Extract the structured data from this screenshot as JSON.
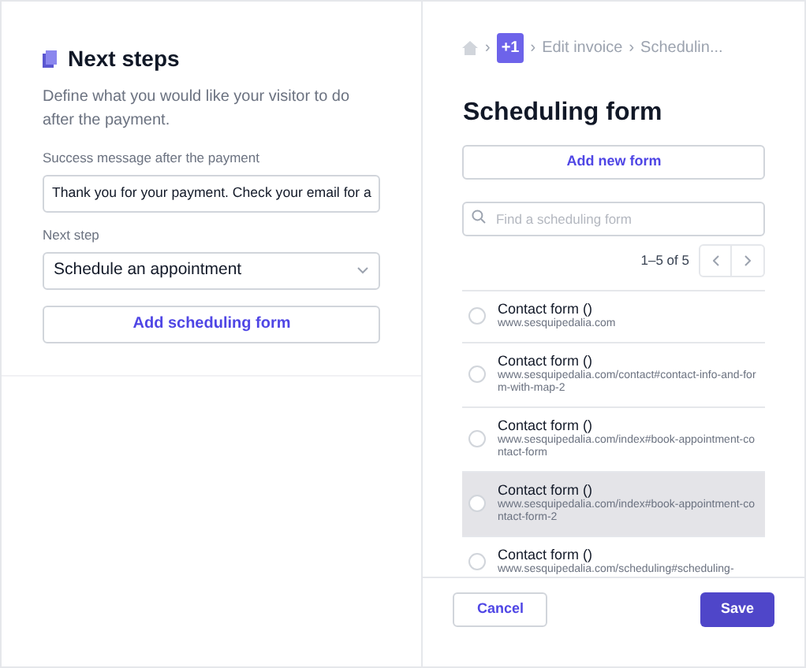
{
  "next_steps": {
    "title": "Next steps",
    "description": "Define what you would like your visitor to do after the payment.",
    "success_message": {
      "label": "Success message after the payment",
      "value": "Thank you for your payment. Check your email for a"
    },
    "next_step": {
      "label": "Next step",
      "value": "Schedule an appointment"
    },
    "add_button": "Add scheduling form"
  },
  "breadcrumb": {
    "separator": "›",
    "badge": "+1",
    "items": [
      "Edit invoice",
      "Schedulin..."
    ]
  },
  "scheduling": {
    "title": "Scheduling form",
    "add_button": "Add new form",
    "search": {
      "placeholder": "Find a scheduling form"
    },
    "pagination": "1–5 of 5",
    "forms": [
      {
        "name": "Contact form ()",
        "url": "www.sesquipedalia.com",
        "selected": false,
        "highlighted": false
      },
      {
        "name": "Contact form ()",
        "url": "www.sesquipedalia.com/contact#contact-info-and-form-with-map-2",
        "selected": false,
        "highlighted": false
      },
      {
        "name": "Contact form ()",
        "url": "www.sesquipedalia.com/index#book-appointment-contact-form",
        "selected": false,
        "highlighted": false
      },
      {
        "name": "Contact form ()",
        "url": "www.sesquipedalia.com/index#book-appointment-contact-form-2",
        "selected": false,
        "highlighted": true
      },
      {
        "name": "Contact form ()",
        "url": "www.sesquipedalia.com/scheduling#scheduling-",
        "selected": false,
        "highlighted": false
      }
    ]
  },
  "footer": {
    "cancel": "Cancel",
    "save": "Save"
  }
}
